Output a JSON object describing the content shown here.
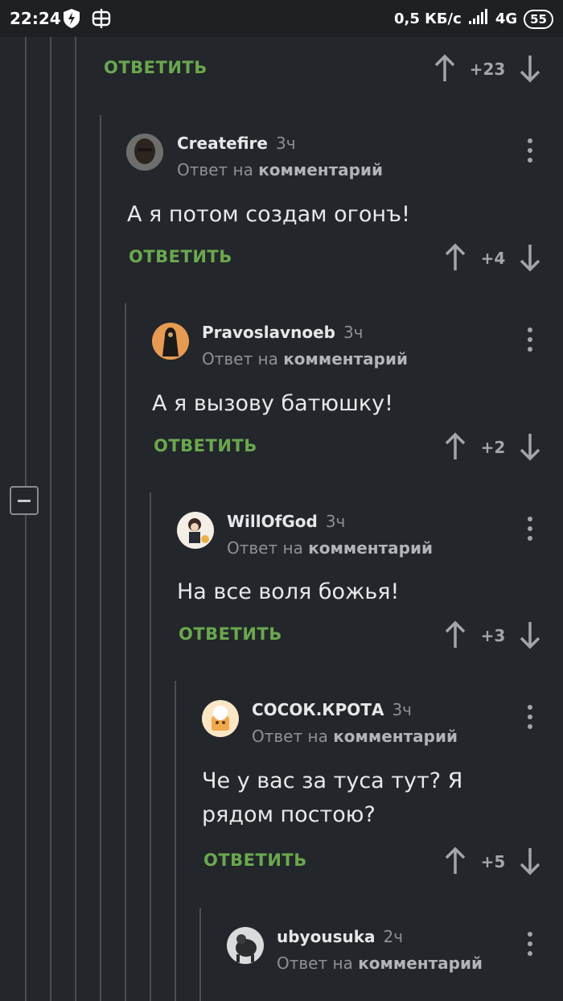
{
  "status_bar": {
    "time": "22:24",
    "network_speed": "0,5 КБ/с",
    "network_type": "4G",
    "battery": "55"
  },
  "top_partial": {
    "reply_label": "ОТВЕТИТЬ",
    "score": "+23"
  },
  "comments": [
    {
      "username": "Createfire",
      "time": "3ч",
      "reply_prefix": "Ответ на",
      "reply_target": "комментарий",
      "text": "А я потом создам огонъ!",
      "reply_label": "ОТВЕТИТЬ",
      "score": "+4"
    },
    {
      "username": "Pravoslavnoeb",
      "time": "3ч",
      "reply_prefix": "Ответ на",
      "reply_target": "комментарий",
      "text": "А я вызову батюшку!",
      "reply_label": "ОТВЕТИТЬ",
      "score": "+2"
    },
    {
      "username": "WillOfGod",
      "time": "3ч",
      "reply_prefix": "Ответ на",
      "reply_target": "комментарий",
      "text": "На все воля божья!",
      "reply_label": "ОТВЕТИТЬ",
      "score": "+3"
    },
    {
      "username": "СОСОК.КРОТА",
      "time": "3ч",
      "reply_prefix": "Ответ на",
      "reply_target": "комментарий",
      "text": "Че у вас за туса тут? Я рядом постою?",
      "reply_label": "ОТВЕТИТЬ",
      "score": "+5"
    },
    {
      "username": "ubyousuka",
      "time": "2ч",
      "reply_prefix": "Ответ на",
      "reply_target": "комментарий",
      "text": "",
      "reply_label": "",
      "score": ""
    }
  ],
  "colors": {
    "background": "#23262a",
    "accent_green": "#6aa84f",
    "thread_line": "#4a4d52"
  }
}
